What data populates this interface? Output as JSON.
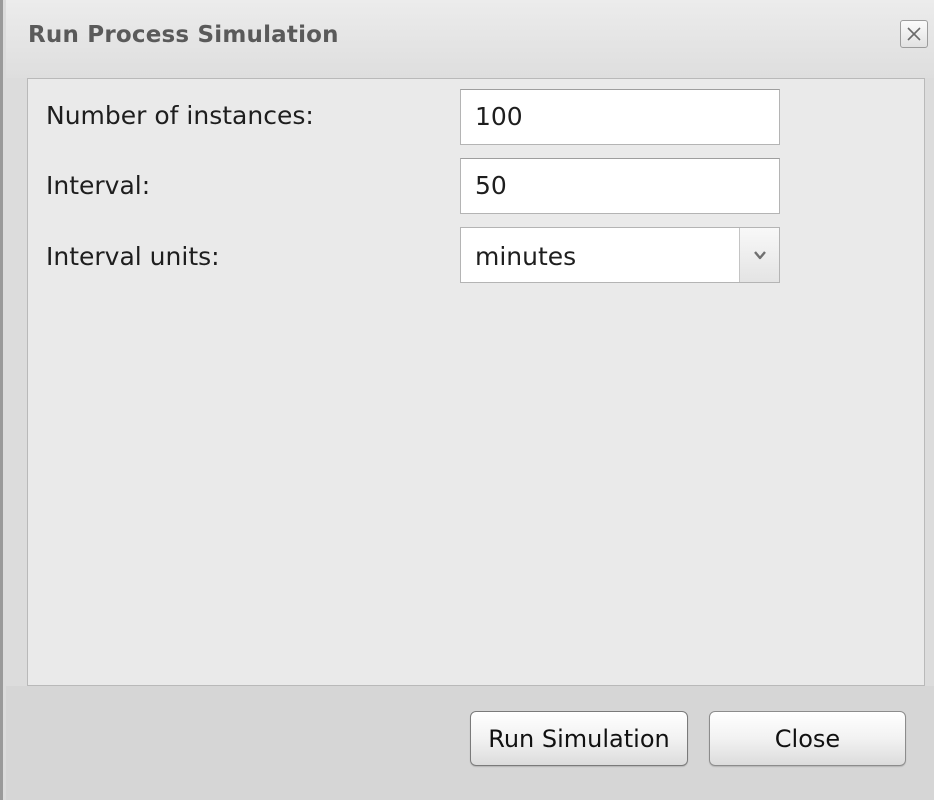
{
  "dialog": {
    "title": "Run Process Simulation",
    "close_icon": "close-x-icon"
  },
  "form": {
    "instances": {
      "label": "Number of instances:",
      "value": "100"
    },
    "interval": {
      "label": "Interval:",
      "value": "50"
    },
    "interval_units": {
      "label": "Interval units:",
      "selected": "minutes",
      "icon": "chevron-down-icon"
    }
  },
  "buttons": {
    "run_label": "Run Simulation",
    "close_label": "Close"
  }
}
